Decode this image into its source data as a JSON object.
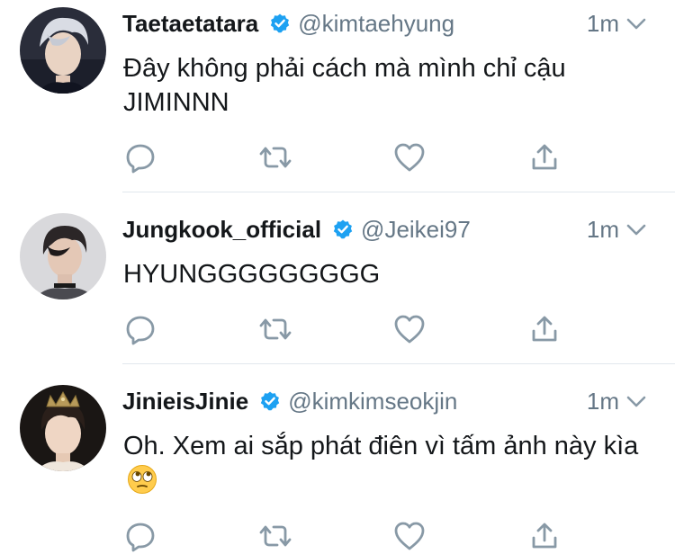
{
  "tweets": [
    {
      "display_name": "Taetaetatara",
      "handle": "@kimtaehyung",
      "time": "1m",
      "text": "Đây không phải cách mà mình chỉ cậu JIMINNN",
      "avatar_icon": "avatar-silver-hair",
      "verified": true
    },
    {
      "display_name": "Jungkook_official",
      "handle": "@Jeikei97",
      "time": "1m",
      "text": "HYUNGGGGGGGGG",
      "avatar_icon": "avatar-dark-hair",
      "verified": true
    },
    {
      "display_name": "JinieisJinie",
      "handle": "@kimkimseokjin",
      "time": "1m",
      "text": "Oh. Xem ai sắp phát điên vì tấm ảnh này kìa",
      "emoji": "rolling-eyes-emoji",
      "avatar_icon": "avatar-crown",
      "verified": true
    }
  ],
  "icons": {
    "verified": "verified-badge-icon",
    "caret": "chevron-down-icon",
    "reply": "reply-icon",
    "retweet": "retweet-icon",
    "like": "heart-icon",
    "share": "share-icon"
  },
  "colors": {
    "verified": "#1da1f2",
    "secondary_text": "#657786",
    "primary_text": "#14171a",
    "divider": "#e1e8ed"
  }
}
